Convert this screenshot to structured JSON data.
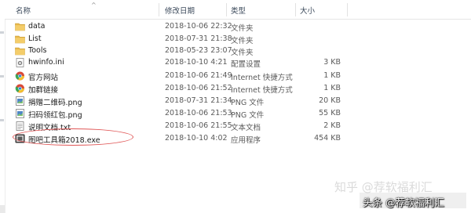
{
  "header": {
    "name_label": "名称",
    "date_label": "修改日期",
    "type_label": "类型",
    "size_label": "大小",
    "sort_caret": "^"
  },
  "files": [
    {
      "name": "data",
      "date": "2018-10-06 22:32",
      "type": "文件夹",
      "size": "",
      "icon": "folder-icon"
    },
    {
      "name": "List",
      "date": "2018-07-31 21:38",
      "type": "文件夹",
      "size": "",
      "icon": "folder-icon"
    },
    {
      "name": "Tools",
      "date": "2018-05-23 23:07",
      "type": "文件夹",
      "size": "",
      "icon": "folder-icon"
    },
    {
      "name": "hwinfo.ini",
      "date": "2018-10-10 4:21",
      "type": "配置设置",
      "size": "3 KB",
      "icon": "settings-file-icon"
    },
    {
      "name": "官方网站",
      "date": "2018-10-06 21:49",
      "type": "Internet 快捷方式",
      "size": "1 KB",
      "icon": "internet-shortcut-icon"
    },
    {
      "name": "加群链接",
      "date": "2018-10-06 21:52",
      "type": "Internet 快捷方式",
      "size": "1 KB",
      "icon": "internet-shortcut-icon"
    },
    {
      "name": "捐赠二维码.png",
      "date": "2018-07-31 21:34",
      "type": "PNG 文件",
      "size": "20 KB",
      "icon": "image-file-icon"
    },
    {
      "name": "扫码领红包.png",
      "date": "2018-10-06 21:53",
      "type": "PNG 文件",
      "size": "55 KB",
      "icon": "image-file-icon"
    },
    {
      "name": "说明文档.txt",
      "date": "2018-10-06 21:55",
      "type": "文本文档",
      "size": "2 KB",
      "icon": "text-file-icon"
    },
    {
      "name": "图吧工具箱2018.exe",
      "date": "2018-10-10 4:02",
      "type": "应用程序",
      "size": "454 KB",
      "icon": "application-icon"
    }
  ],
  "watermarks": {
    "zhihu": "知乎 @荐软福利汇",
    "toutiao": "头条 @荐软福利汇"
  },
  "colors": {
    "folder": "#e8b84a",
    "header_text": "#3d4b5c",
    "circle": "#e05656",
    "chrome": "#2f8bd6"
  }
}
